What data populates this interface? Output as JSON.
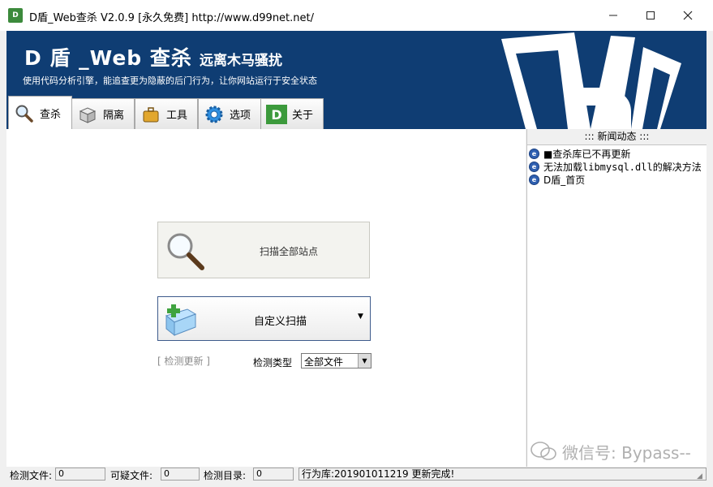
{
  "window": {
    "title": "D盾_Web查杀 V2.0.9 [永久免费] http://www.d99net.net/",
    "app_icon": "D",
    "icon_names": {
      "min": "minimize-icon",
      "max": "maximize-icon",
      "close": "close-icon"
    }
  },
  "banner": {
    "title": "D 盾 _Web 查杀",
    "subtitle": "远离木马骚扰",
    "tagline": "使用代码分析引擎，能追查更为隐蔽的后门行为，让你网站运行于安全状态"
  },
  "tabs": [
    {
      "label": "查杀",
      "icon": "magnifier-icon",
      "active": true
    },
    {
      "label": "隔离",
      "icon": "box-icon",
      "active": false
    },
    {
      "label": "工具",
      "icon": "briefcase-icon",
      "active": false
    },
    {
      "label": "选项",
      "icon": "gear-icon",
      "active": false
    },
    {
      "label": "关于",
      "icon": "d-logo-icon",
      "active": false
    }
  ],
  "main": {
    "scan_all_label": "扫描全部站点",
    "custom_scan_label": "自定义扫描",
    "check_update": "[ 检测更新 ]",
    "detect_type_label": "检测类型",
    "detect_type_value": "全部文件"
  },
  "news": {
    "header": "::: 新闻动态 :::",
    "items": [
      {
        "label": "■查杀库已不再更新"
      },
      {
        "label": "无法加载libmysql.dll的解决方法"
      },
      {
        "label": "D盾_首页"
      }
    ],
    "watermark": "微信号: Bypass--"
  },
  "statusbar": {
    "files_label": "检测文件:",
    "files_value": "0",
    "suspicious_label": "可疑文件:",
    "suspicious_value": "0",
    "dirs_label": "检测目录:",
    "dirs_value": "0",
    "message": "行为库:201901011219  更新完成!"
  },
  "colors": {
    "banner_bg": "#0f3d73",
    "accent": "#3e5b8c"
  }
}
